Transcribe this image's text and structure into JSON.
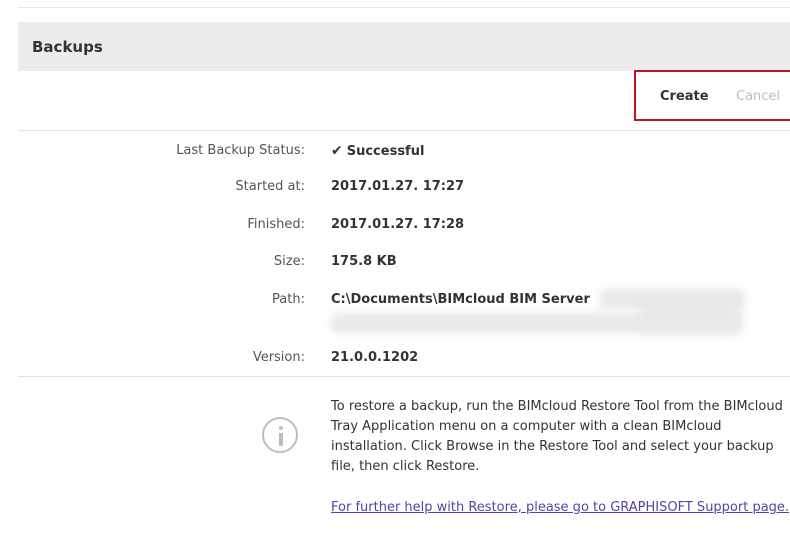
{
  "section": {
    "title": "Backups"
  },
  "actions": {
    "create_label": "Create",
    "cancel_label": "Cancel"
  },
  "details": [
    {
      "label": "Last Backup Status:",
      "value": "Successful",
      "icon": "check-icon"
    },
    {
      "label": "Started at:",
      "value": "2017.01.27. 17:27"
    },
    {
      "label": "Finished:",
      "value": "2017.01.27. 17:28"
    },
    {
      "label": "Size:",
      "value": "175.8 KB"
    },
    {
      "label": "Path:",
      "value": "C:\\Documents\\BIMcloud BIM Server"
    },
    {
      "label": "Version:",
      "value": "21.0.0.1202"
    }
  ],
  "info": {
    "icon": "info-icon",
    "text": "To restore a backup, run the BIMcloud Restore Tool from the BIMcloud Tray Application menu on a computer with a clean BIMcloud installation. Click Browse in the Restore Tool and select your backup file, then click Restore.",
    "link_text": "For further help with Restore, please go to GRAPHISOFT Support page."
  },
  "colors": {
    "highlight_border": "#c0141c",
    "header_bg": "#ececec",
    "link": "#5b3fa6"
  }
}
